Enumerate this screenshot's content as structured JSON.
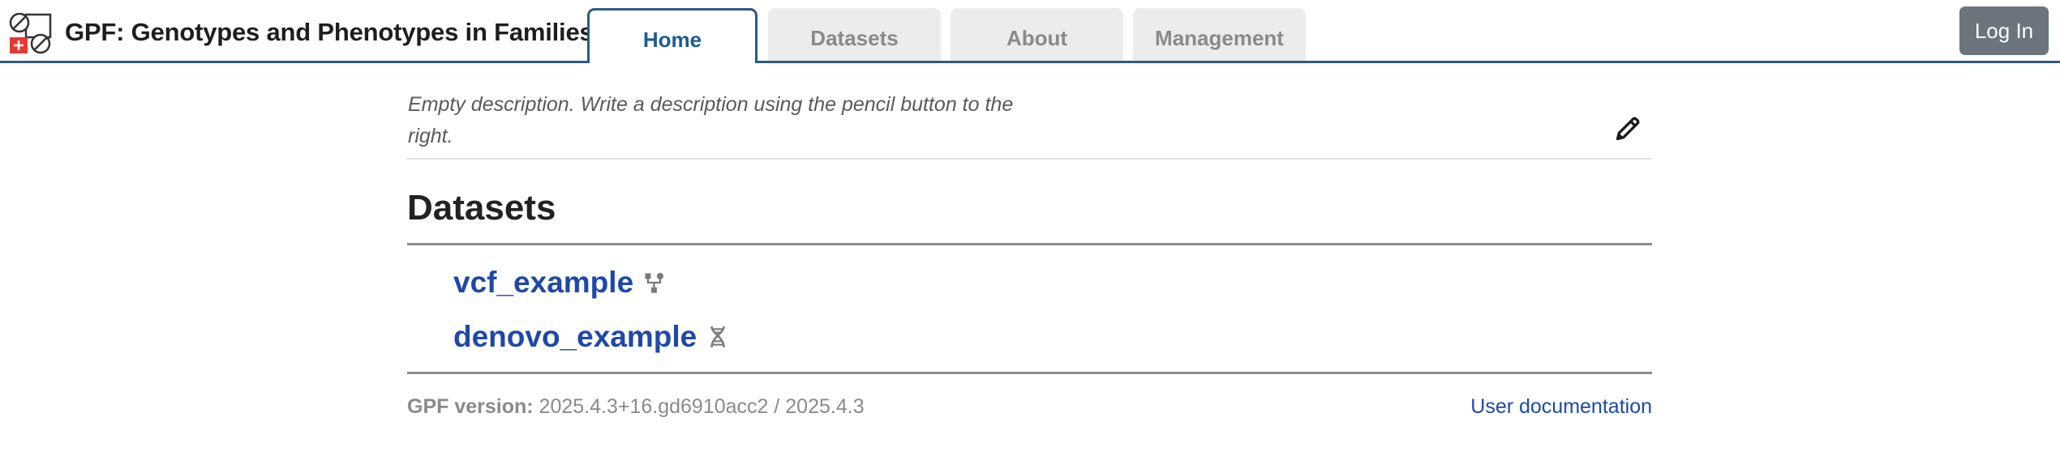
{
  "header": {
    "app_title": "GPF: Genotypes and Phenotypes in Families",
    "tabs": [
      {
        "label": "Home",
        "active": true
      },
      {
        "label": "Datasets",
        "active": false
      },
      {
        "label": "About",
        "active": false
      },
      {
        "label": "Management",
        "active": false
      }
    ],
    "login_label": "Log In",
    "accent_color": "#2c5a88"
  },
  "main": {
    "description": "Empty description. Write a description using the pencil button to the right.",
    "edit_icon": "pencil-icon",
    "section_title": "Datasets",
    "datasets": [
      {
        "name": "vcf_example",
        "icon": "family-tree-icon"
      },
      {
        "name": "denovo_example",
        "icon": "dna-icon"
      }
    ],
    "link_color": "#1f48a8"
  },
  "footer": {
    "version_label": "GPF version:",
    "version_value": "2025.4.3+16.gd6910acc2 / 2025.4.3",
    "user_doc_label": "User documentation"
  }
}
